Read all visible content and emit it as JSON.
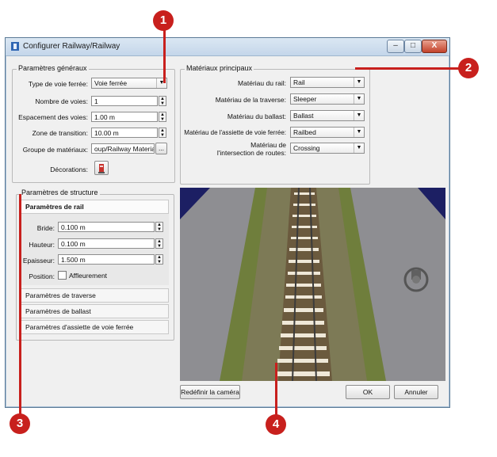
{
  "window": {
    "title": "Configurer Railway/Railway",
    "min_glyph": "–",
    "max_glyph": "□",
    "close_glyph": "X"
  },
  "general": {
    "legend": "Paramètres généraux",
    "type_label": "Type de voie ferrée:",
    "type_value": "Voie ferrée",
    "tracks_label": "Nombre de voies:",
    "tracks_value": "1",
    "spacing_label": "Espacement des voies:",
    "spacing_value": "1.00 m",
    "transition_label": "Zone de transition:",
    "transition_value": "10.00 m",
    "material_group_label": "Groupe de matériaux:",
    "material_group_value": "oup/Railway Materials",
    "browse_label": "...",
    "decorations_label": "Décorations:"
  },
  "materials": {
    "legend": "Matériaux principaux",
    "items": [
      {
        "label": "Matériau du rail:",
        "value": "Rail"
      },
      {
        "label": "Matériau de la traverse:",
        "value": "Sleeper"
      },
      {
        "label": "Matériau du ballast:",
        "value": "Ballast"
      },
      {
        "label": "Matériau de l'assiette de voie ferrée:",
        "value": "Railbed"
      }
    ],
    "crossing_label_1": "Matériau de",
    "crossing_label_2": "l'intersection de routes:",
    "crossing_value": "Crossing"
  },
  "structure": {
    "legend": "Paramètres de structure",
    "rail_tab": "Paramètres de rail",
    "flange_label": "Bride:",
    "flange_value": "0.100 m",
    "height_label": "Hauteur:",
    "height_value": "0.100 m",
    "thickness_label": "Epaisseur:",
    "thickness_value": "1.500 m",
    "position_label": "Position:",
    "flush_label": "Affleurement",
    "flush_checked": false,
    "tabs": [
      "Paramètres de traverse",
      "Paramètres de ballast",
      "Paramètres d'assiette de voie ferrée"
    ]
  },
  "buttons": {
    "reset_camera": "Redéfinir la caméra",
    "ok": "OK",
    "cancel": "Annuler"
  },
  "callouts": [
    "1",
    "2",
    "3",
    "4"
  ],
  "colors": {
    "accent_callout": "#c8201d",
    "viewport_sky": "#1c1f63",
    "ground": "#8e8e92"
  }
}
